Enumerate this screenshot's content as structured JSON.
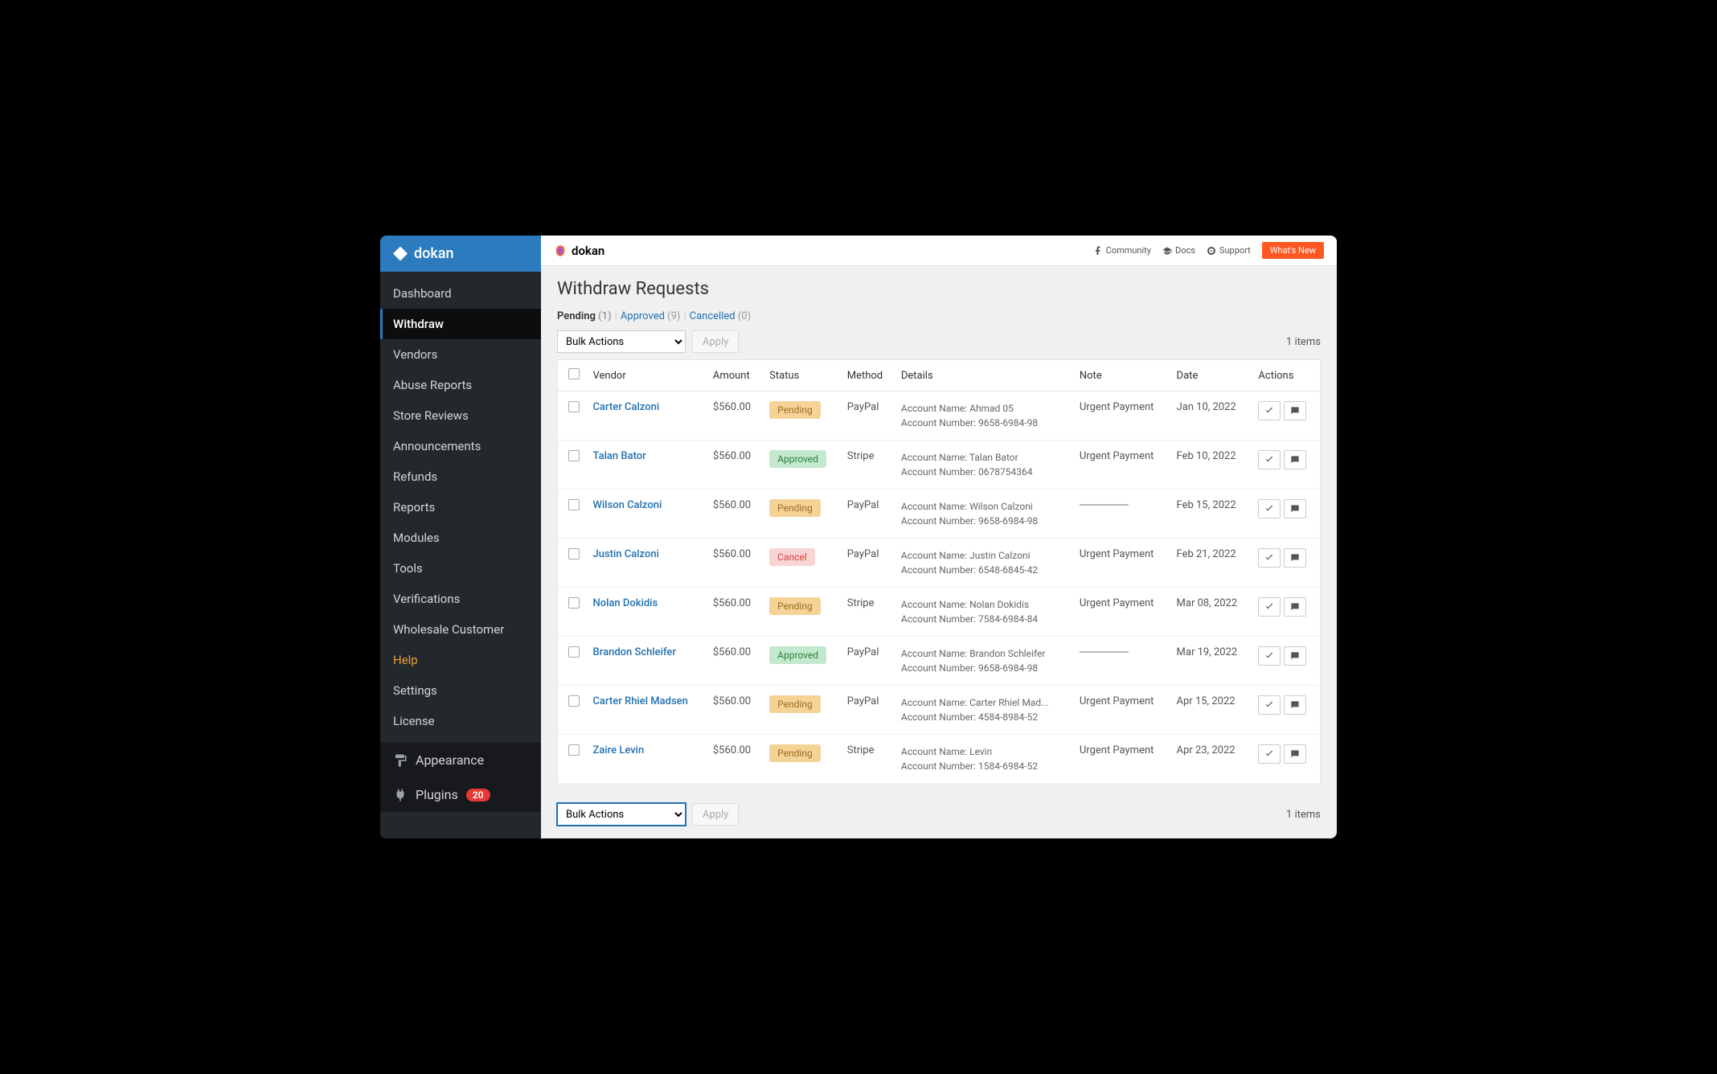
{
  "brand": "dokan",
  "sidebar": {
    "items": [
      {
        "label": "Dashboard"
      },
      {
        "label": "Withdraw",
        "active": true
      },
      {
        "label": "Vendors"
      },
      {
        "label": "Abuse Reports"
      },
      {
        "label": "Store Reviews"
      },
      {
        "label": "Announcements"
      },
      {
        "label": "Refunds"
      },
      {
        "label": "Reports"
      },
      {
        "label": "Modules"
      },
      {
        "label": "Tools"
      },
      {
        "label": "Verifications"
      },
      {
        "label": "Wholesale Customer"
      },
      {
        "label": "Help",
        "highlight": true
      },
      {
        "label": "Settings"
      },
      {
        "label": "License"
      }
    ],
    "footer": [
      {
        "label": "Appearance",
        "icon": "paint"
      },
      {
        "label": "Plugins",
        "icon": "plug",
        "badge": "20"
      }
    ]
  },
  "topbar": {
    "links": [
      {
        "label": "Community",
        "icon": "facebook"
      },
      {
        "label": "Docs",
        "icon": "grad"
      },
      {
        "label": "Support",
        "icon": "support"
      }
    ],
    "whats_new": "What's New"
  },
  "page": {
    "title": "Withdraw Requests",
    "tabs": [
      {
        "label": "Pending",
        "count": "(1)",
        "active": true
      },
      {
        "label": "Approved",
        "count": "(9)"
      },
      {
        "label": "Cancelled",
        "count": "(0)"
      }
    ],
    "bulk_label": "Bulk Actions",
    "apply_label": "Apply",
    "items_count": "1 items",
    "columns": [
      "Vendor",
      "Amount",
      "Status",
      "Method",
      "Details",
      "Note",
      "Date",
      "Actions"
    ],
    "rows": [
      {
        "vendor": "Carter Calzoni",
        "amount": "$560.00",
        "status": "Pending",
        "status_class": "pending",
        "method": "PayPal",
        "d1": "Account Name: Ahmad 05",
        "d2": "Account Number: 9658-6984-98",
        "note": "Urgent Payment",
        "date": "Jan 10, 2022"
      },
      {
        "vendor": "Talan Bator",
        "amount": "$560.00",
        "status": "Approved",
        "status_class": "approved",
        "method": "Stripe",
        "d1": "Account Name: Talan Bator",
        "d2": "Account Number: 0678754364",
        "note": "Urgent Payment",
        "date": "Feb 10, 2022"
      },
      {
        "vendor": "Wilson Calzoni",
        "amount": "$560.00",
        "status": "Pending",
        "status_class": "pending",
        "method": "PayPal",
        "d1": "Account Name: Wilson Calzoni",
        "d2": "Account Number: 9658-6984-98",
        "note": "-----------------",
        "date": "Feb 15, 2022"
      },
      {
        "vendor": "Justin Calzoni",
        "amount": "$560.00",
        "status": "Cancel",
        "status_class": "cancel",
        "method": "PayPal",
        "d1": "Account Name: Justin Calzoni",
        "d2": "Account Number: 6548-6845-42",
        "note": "Urgent Payment",
        "date": "Feb 21, 2022"
      },
      {
        "vendor": "Nolan Dokidis",
        "amount": "$560.00",
        "status": "Pending",
        "status_class": "pending",
        "method": "Stripe",
        "d1": "Account Name: Nolan Dokidis",
        "d2": "Account Number: 7584-6984-84",
        "note": "Urgent Payment",
        "date": "Mar 08, 2022"
      },
      {
        "vendor": "Brandon Schleifer",
        "amount": "$560.00",
        "status": "Approved",
        "status_class": "approved",
        "method": "PayPal",
        "d1": "Account Name: Brandon Schleifer",
        "d2": "Account Number:  9658-6984-98",
        "note": "-----------------",
        "date": "Mar 19, 2022"
      },
      {
        "vendor": "Carter Rhiel Madsen",
        "amount": "$560.00",
        "status": "Pending",
        "status_class": "pending",
        "method": "PayPal",
        "d1": "Account Name: Carter Rhiel Mad...",
        "d2": "Account Number: 4584-8984-52",
        "note": "Urgent Payment",
        "date": "Apr 15, 2022"
      },
      {
        "vendor": "Zaire Levin",
        "amount": "$560.00",
        "status": "Pending",
        "status_class": "pending",
        "method": "Stripe",
        "d1": "Account Name: Levin",
        "d2": "Account Number: 1584-6984-52",
        "note": "Urgent Payment",
        "date": "Apr 23, 2022"
      }
    ]
  }
}
